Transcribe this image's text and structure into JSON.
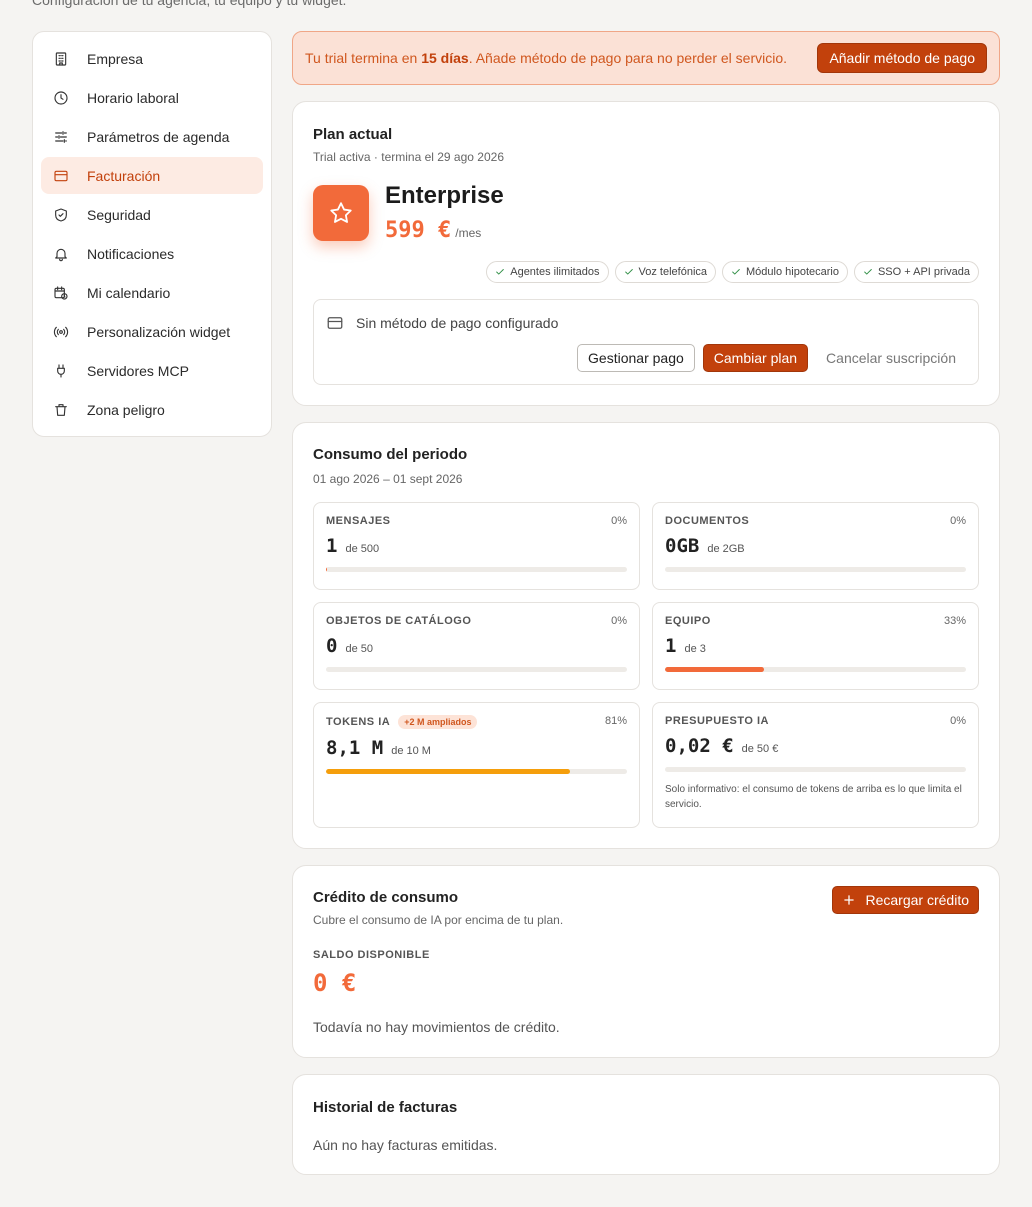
{
  "page": {
    "subtitle": "Configuración de tu agencia, tu equipo y tu widget."
  },
  "sidebar": {
    "items": [
      {
        "label": "Empresa",
        "icon": "building-icon"
      },
      {
        "label": "Horario laboral",
        "icon": "clock-icon"
      },
      {
        "label": "Parámetros de agenda",
        "icon": "sliders-icon"
      },
      {
        "label": "Facturación",
        "icon": "credit-card-icon",
        "active": true
      },
      {
        "label": "Seguridad",
        "icon": "shield-check-icon"
      },
      {
        "label": "Notificaciones",
        "icon": "bell-icon"
      },
      {
        "label": "Mi calendario",
        "icon": "calendar-clock-icon"
      },
      {
        "label": "Personalización widget",
        "icon": "radio-icon"
      },
      {
        "label": "Servidores MCP",
        "icon": "plug-icon"
      },
      {
        "label": "Zona peligro",
        "icon": "trash-icon"
      }
    ]
  },
  "banner": {
    "text_before": "Tu trial termina en ",
    "days": "15 días",
    "text_after": ". Añade método de pago para no perder el servicio.",
    "button": "Añadir método de pago"
  },
  "plan": {
    "title": "Plan actual",
    "status": "Trial activa · termina el 29 ago 2026",
    "name": "Enterprise",
    "price": "599 €",
    "period": "/mes",
    "features": [
      "Agentes ilimitados",
      "Voz telefónica",
      "Módulo hipotecario",
      "SSO + API privada"
    ],
    "payment_status": "Sin método de pago configurado",
    "manage_button": "Gestionar pago",
    "change_button": "Cambiar plan",
    "cancel_button": "Cancelar suscripción"
  },
  "usage": {
    "title": "Consumo del periodo",
    "range": "01 ago 2026 – 01 sept 2026",
    "items": [
      {
        "label": "MENSAJES",
        "pct": "0%",
        "value": "1",
        "of": "de 500",
        "fill": 0.002,
        "color": "#f26a3a"
      },
      {
        "label": "DOCUMENTOS",
        "pct": "0%",
        "value": "0GB",
        "of": "de 2GB",
        "fill": 0,
        "color": "#f26a3a"
      },
      {
        "label": "OBJETOS DE CATÁLOGO",
        "pct": "0%",
        "value": "0",
        "of": "de 50",
        "fill": 0,
        "color": "#f26a3a"
      },
      {
        "label": "EQUIPO",
        "pct": "33%",
        "value": "1",
        "of": "de 3",
        "fill": 0.33,
        "color": "#f26a3a"
      },
      {
        "label": "TOKENS IA",
        "tag": "+2 M ampliados",
        "pct": "81%",
        "value": "8,1 M",
        "of": "de 10 M",
        "fill": 0.81,
        "color": "#f59e0b"
      },
      {
        "label": "PRESUPUESTO IA",
        "pct": "0%",
        "value": "0,02 €",
        "of": "de 50 €",
        "fill": 0,
        "color": "#f26a3a",
        "note": "Solo informativo: el consumo de tokens de arriba es lo que limita el servicio."
      }
    ]
  },
  "credit": {
    "title": "Crédito de consumo",
    "subtitle": "Cubre el consumo de IA por encima de tu plan.",
    "button": "Recargar crédito",
    "balance_label": "SALDO DISPONIBLE",
    "balance": "0 €",
    "empty": "Todavía no hay movimientos de crédito."
  },
  "invoices": {
    "title": "Historial de facturas",
    "empty": "Aún no hay facturas emitidas."
  }
}
